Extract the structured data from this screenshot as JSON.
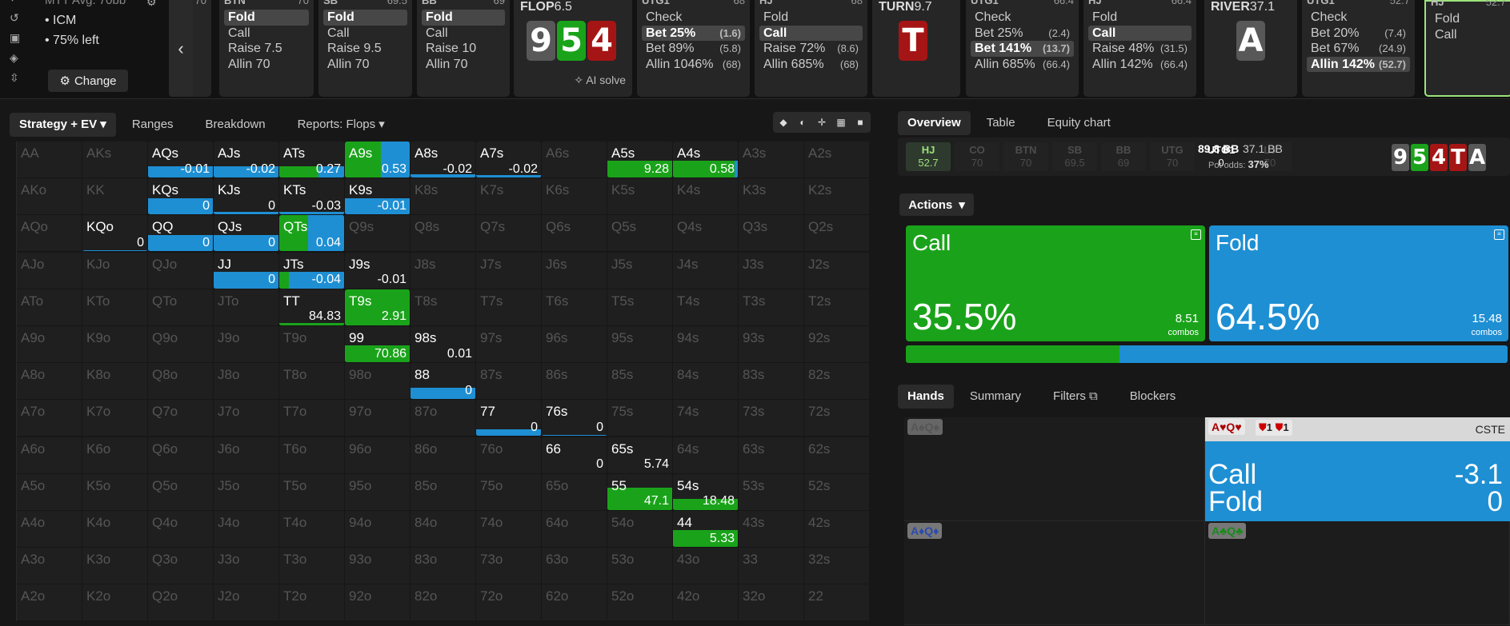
{
  "left": {
    "game": "MTT Avg. 70bb",
    "icm": "ICM",
    "left": "75% left",
    "change": "Change"
  },
  "history": [
    {
      "pos": "BTN",
      "stack": "70",
      "acts": [
        {
          "l": "Fold",
          "a": "",
          "sel": true
        },
        {
          "l": "Call",
          "a": ""
        },
        {
          "l": "Raise 7.5",
          "a": ""
        },
        {
          "l": "Allin 70",
          "a": ""
        }
      ]
    },
    {
      "pos": "SB",
      "stack": "69.5",
      "acts": [
        {
          "l": "Fold",
          "a": "",
          "sel": true
        },
        {
          "l": "Call",
          "a": ""
        },
        {
          "l": "Raise 9.5",
          "a": ""
        },
        {
          "l": "Allin 70",
          "a": ""
        }
      ]
    },
    {
      "pos": "BB",
      "stack": "69",
      "acts": [
        {
          "l": "Fold",
          "a": "",
          "sel": true
        },
        {
          "l": "Call",
          "a": ""
        },
        {
          "l": "Raise 10",
          "a": ""
        },
        {
          "l": "Allin 70",
          "a": ""
        }
      ]
    },
    {
      "pos": "UTG1",
      "stack": "68",
      "acts": [
        {
          "l": "Check",
          "a": ""
        },
        {
          "l": "Bet 25%",
          "a": "(1.6)",
          "sel": true
        },
        {
          "l": "Bet 89%",
          "a": "(5.8)"
        },
        {
          "l": "Allin 1046%",
          "a": "(68)"
        }
      ]
    },
    {
      "pos": "HJ",
      "stack": "68",
      "acts": [
        {
          "l": "Fold",
          "a": ""
        },
        {
          "l": "Call",
          "a": "",
          "sel": true
        },
        {
          "l": "Raise 72%",
          "a": "(8.6)"
        },
        {
          "l": "Allin 685%",
          "a": "(68)"
        }
      ]
    },
    {
      "pos": "UTG1",
      "stack": "66.4",
      "acts": [
        {
          "l": "Check",
          "a": ""
        },
        {
          "l": "Bet 25%",
          "a": "(2.4)"
        },
        {
          "l": "Bet 141%",
          "a": "(13.7)",
          "sel": true
        },
        {
          "l": "Allin 685%",
          "a": "(66.4)"
        }
      ]
    },
    {
      "pos": "HJ",
      "stack": "66.4",
      "acts": [
        {
          "l": "Fold",
          "a": ""
        },
        {
          "l": "Call",
          "a": "",
          "sel": true
        },
        {
          "l": "Raise 48%",
          "a": "(31.5)"
        },
        {
          "l": "Allin 142%",
          "a": "(66.4)"
        }
      ]
    },
    {
      "pos": "UTG1",
      "stack": "52.7",
      "acts": [
        {
          "l": "Check",
          "a": ""
        },
        {
          "l": "Bet 20%",
          "a": "(7.4)"
        },
        {
          "l": "Bet 67%",
          "a": "(24.9)"
        },
        {
          "l": "Allin 142%",
          "a": "(52.7)",
          "sel": true
        }
      ]
    },
    {
      "pos": "HJ",
      "stack": "52.7",
      "acts": [
        {
          "l": "Fold",
          "a": ""
        },
        {
          "l": "Call",
          "a": ""
        }
      ]
    }
  ],
  "extra_stack": "70",
  "flop": {
    "label": "FLOP",
    "pot": "6.5",
    "cards": [
      "9",
      "5",
      "4"
    ],
    "ai": "AI solve"
  },
  "turn": {
    "label": "TURN",
    "pot": "9.7",
    "card": "T"
  },
  "river": {
    "label": "RIVER",
    "pot": "37.1",
    "card": "A"
  },
  "tabs_left": [
    "Strategy + EV",
    "Ranges",
    "Breakdown",
    "Reports: Flops"
  ],
  "tabs_right": [
    "Overview",
    "Table",
    "Equity chart"
  ],
  "players": [
    {
      "n": "HJ",
      "v": "52.7",
      "s": "hero"
    },
    {
      "n": "CO",
      "v": "70",
      "s": "off"
    },
    {
      "n": "BTN",
      "v": "70",
      "s": "off"
    },
    {
      "n": "SB",
      "v": "69.5",
      "s": "off"
    },
    {
      "n": "BB",
      "v": "69",
      "s": "off"
    },
    {
      "n": "UTG",
      "v": "70",
      "s": "off"
    },
    {
      "n": "UTG1",
      "v": "0",
      "s": "cur"
    },
    {
      "n": "LJ",
      "v": "70",
      "s": "off"
    }
  ],
  "pot": {
    "main": "89.8 BB",
    "side": "37.1 BB",
    "odds_label": "Pot odds:",
    "odds": "37%"
  },
  "board_small": [
    "9",
    "5",
    "4",
    "T",
    "A"
  ],
  "actions_label": "Actions",
  "call_box": {
    "title": "Call",
    "pct": "35.5%",
    "combos": "8.51",
    "combos_label": "combos",
    "color": "#1aa31a"
  },
  "fold_box": {
    "title": "Fold",
    "pct": "64.5%",
    "combos": "15.48",
    "combos_label": "combos",
    "color": "#1e8fd3"
  },
  "call_frac": 35.5,
  "hands_tabs": [
    "Hands",
    "Summary",
    "Filters",
    "Blockers"
  ],
  "hands": [
    {
      "tag": "A♠Q♠"
    },
    {
      "tag": "A♥Q♥"
    },
    {
      "tag": "A♦Q♦"
    },
    {
      "tag": "A♣Q♣"
    }
  ],
  "selected_hand": {
    "blockers": "1",
    "blockers2": "1",
    "cste": "CSTE",
    "call_l": "Call",
    "call_v": "-3.1",
    "fold_l": "Fold",
    "fold_v": "0"
  },
  "grid": [
    [
      "AA",
      "AKs",
      "AQs",
      "AJs",
      "ATs",
      "A9s",
      "A8s",
      "A7s",
      "A6s",
      "A5s",
      "A4s",
      "A3s",
      "A2s"
    ],
    [
      "AKo",
      "KK",
      "KQs",
      "KJs",
      "KTs",
      "K9s",
      "K8s",
      "K7s",
      "K6s",
      "K5s",
      "K4s",
      "K3s",
      "K2s"
    ],
    [
      "AQo",
      "KQo",
      "QQ",
      "QJs",
      "QTs",
      "Q9s",
      "Q8s",
      "Q7s",
      "Q6s",
      "Q5s",
      "Q4s",
      "Q3s",
      "Q2s"
    ],
    [
      "AJo",
      "KJo",
      "QJo",
      "JJ",
      "JTs",
      "J9s",
      "J8s",
      "J7s",
      "J6s",
      "J5s",
      "J4s",
      "J3s",
      "J2s"
    ],
    [
      "ATo",
      "KTo",
      "QTo",
      "JTo",
      "TT",
      "T9s",
      "T8s",
      "T7s",
      "T6s",
      "T5s",
      "T4s",
      "T3s",
      "T2s"
    ],
    [
      "A9o",
      "K9o",
      "Q9o",
      "J9o",
      "T9o",
      "99",
      "98s",
      "97s",
      "96s",
      "95s",
      "94s",
      "93s",
      "92s"
    ],
    [
      "A8o",
      "K8o",
      "Q8o",
      "J8o",
      "T8o",
      "98o",
      "88",
      "87s",
      "86s",
      "85s",
      "84s",
      "83s",
      "82s"
    ],
    [
      "A7o",
      "K7o",
      "Q7o",
      "J7o",
      "T7o",
      "97o",
      "87o",
      "77",
      "76s",
      "75s",
      "74s",
      "73s",
      "72s"
    ],
    [
      "A6o",
      "K6o",
      "Q6o",
      "J6o",
      "T6o",
      "96o",
      "86o",
      "76o",
      "66",
      "65s",
      "64s",
      "63s",
      "62s"
    ],
    [
      "A5o",
      "K5o",
      "Q5o",
      "J5o",
      "T5o",
      "95o",
      "85o",
      "75o",
      "65o",
      "55",
      "54s",
      "53s",
      "52s"
    ],
    [
      "A4o",
      "K4o",
      "Q4o",
      "J4o",
      "T4o",
      "94o",
      "84o",
      "74o",
      "64o",
      "54o",
      "44",
      "43s",
      "42s"
    ],
    [
      "A3o",
      "K3o",
      "Q3o",
      "J3o",
      "T3o",
      "93o",
      "83o",
      "73o",
      "63o",
      "53o",
      "43o",
      "33",
      "32s"
    ],
    [
      "A2o",
      "K2o",
      "Q2o",
      "J2o",
      "T2o",
      "92o",
      "82o",
      "72o",
      "62o",
      "52o",
      "42o",
      "32o",
      "22"
    ]
  ],
  "grid_vals": {
    "AQs": {
      "v": "-0.01",
      "g": 0,
      "h": 0.3
    },
    "AJs": {
      "v": "-0.02",
      "g": 0,
      "h": 0.3
    },
    "ATs": {
      "v": "0.27",
      "g": 0.6,
      "h": 0.3
    },
    "A9s": {
      "v": "0.53",
      "g": 0.55,
      "h": 1
    },
    "A8s": {
      "v": "-0.02",
      "g": 0,
      "h": 0.08
    },
    "A7s": {
      "v": "-0.02",
      "g": 0,
      "h": 0.06
    },
    "A5s": {
      "v": "9.28",
      "g": 1,
      "h": 0.45
    },
    "A4s": {
      "v": "0.58",
      "g": 0.95,
      "h": 0.45
    },
    "KQs": {
      "v": "0",
      "g": 0,
      "h": 0.45
    },
    "KJs": {
      "v": "0",
      "g": 0,
      "h": 0.08
    },
    "KTs": {
      "v": "-0.03",
      "g": 0,
      "h": 0.08
    },
    "K9s": {
      "v": "-0.01",
      "g": 0,
      "h": 0.45
    },
    "KQo": {
      "v": "0",
      "g": 0,
      "h": 0.04
    },
    "QQ": {
      "v": "0",
      "g": 0,
      "h": 0.45
    },
    "QJs": {
      "v": "0",
      "g": 0,
      "h": 0.45
    },
    "QTs": {
      "v": "0.04",
      "g": 0.45,
      "h": 1
    },
    "JJ": {
      "v": "0",
      "g": 0,
      "h": 0.45
    },
    "JTs": {
      "v": "-0.04",
      "g": 0.15,
      "h": 0.45
    },
    "J9s": {
      "v": "-0.01",
      "g": 0,
      "h": 0
    },
    "TT": {
      "v": "84.83",
      "g": 1,
      "h": 0.06
    },
    "T9s": {
      "v": "2.91",
      "g": 1,
      "h": 1
    },
    "99": {
      "v": "70.86",
      "g": 1,
      "h": 0.45
    },
    "98s": {
      "v": "0.01",
      "g": 0,
      "h": 0
    },
    "88": {
      "v": "0",
      "g": 0,
      "h": 0.3
    },
    "77": {
      "v": "0",
      "g": 0,
      "h": 0.18
    },
    "76s": {
      "v": "0",
      "g": 0,
      "h": 0.04
    },
    "66": {
      "v": "0",
      "g": 0,
      "h": 0
    },
    "65s": {
      "v": "5.74",
      "g": 0,
      "h": 0
    },
    "55": {
      "v": "47.1",
      "g": 1,
      "h": 0.6
    },
    "54s": {
      "v": "18.48",
      "g": 1,
      "h": 0.3
    },
    "44": {
      "v": "5.33",
      "g": 1,
      "h": 0.45
    }
  }
}
